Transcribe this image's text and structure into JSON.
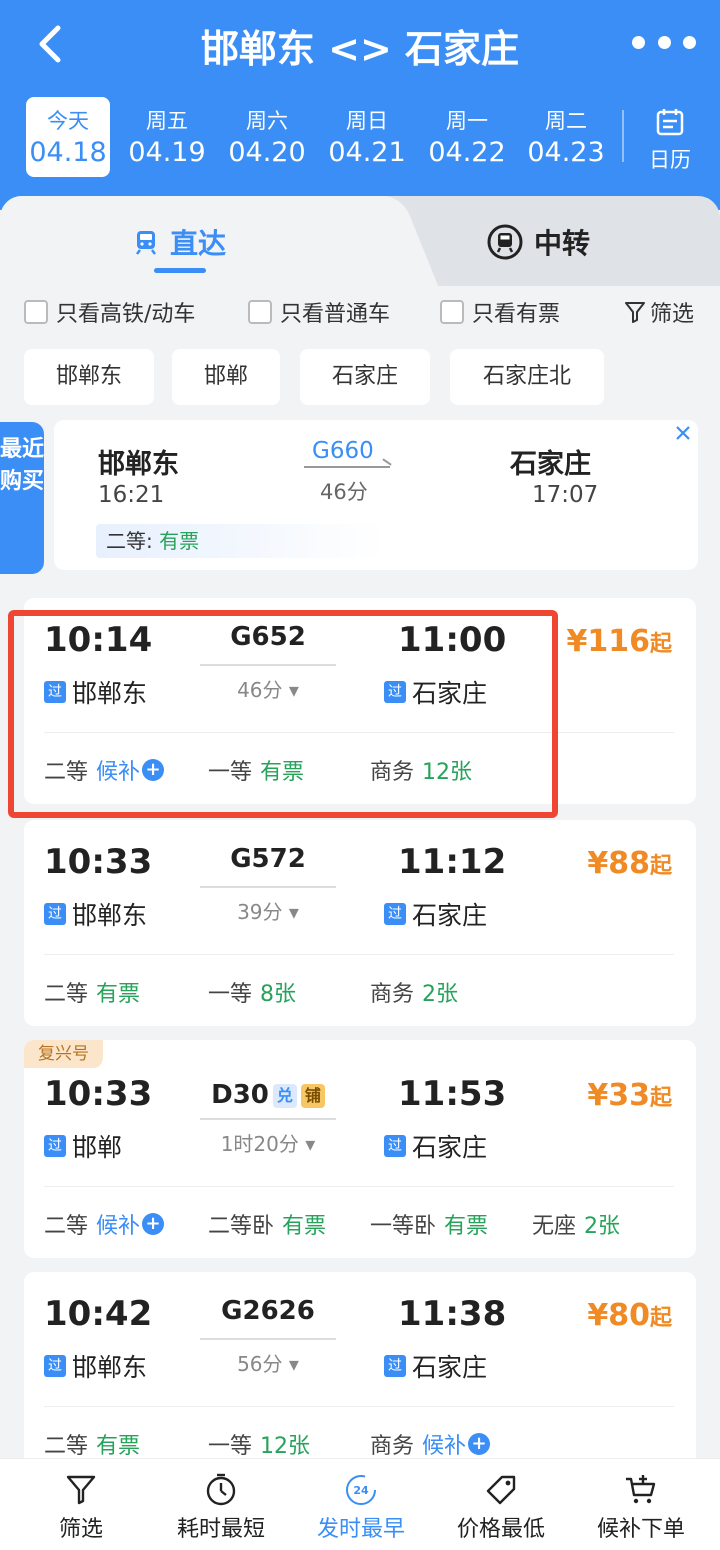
{
  "header": {
    "title": "邯郸东 <> 石家庄",
    "calendar_label": "日历"
  },
  "dates": [
    {
      "week": "今天",
      "date": "04.18",
      "active": true
    },
    {
      "week": "周五",
      "date": "04.19"
    },
    {
      "week": "周六",
      "date": "04.20"
    },
    {
      "week": "周日",
      "date": "04.21"
    },
    {
      "week": "周一",
      "date": "04.22"
    },
    {
      "week": "周二",
      "date": "04.23"
    }
  ],
  "tabs": {
    "direct": "直达",
    "transfer": "中转"
  },
  "filters": {
    "only_gd": "只看高铁/动车",
    "only_normal": "只看普通车",
    "only_available": "只看有票",
    "filter": "筛选"
  },
  "stations": [
    "邯郸东",
    "邯郸",
    "石家庄",
    "石家庄北"
  ],
  "recent": {
    "tag": "最近购买",
    "from": "邯郸东",
    "from_time": "16:21",
    "train": "G660",
    "duration": "46分",
    "to": "石家庄",
    "to_time": "17:07",
    "seat_class": "二等:",
    "seat_status": "有票"
  },
  "trains": [
    {
      "dep": "10:14",
      "arr": "11:00",
      "no": "G652",
      "duration": "46分",
      "from_pass": "过",
      "from": "邯郸东",
      "to_pass": "过",
      "to": "石家庄",
      "price_sym": "¥",
      "price": "116",
      "price_suffix": "起",
      "seats": [
        {
          "cls": "二等",
          "status": "候补"
        },
        {
          "cls": "一等",
          "status": "有票"
        },
        {
          "cls": "商务",
          "status": "12张"
        }
      ]
    },
    {
      "dep": "10:33",
      "arr": "11:12",
      "no": "G572",
      "duration": "39分",
      "from_pass": "过",
      "from": "邯郸东",
      "to_pass": "过",
      "to": "石家庄",
      "price_sym": "¥",
      "price": "88",
      "price_suffix": "起",
      "seats": [
        {
          "cls": "二等",
          "status": "有票"
        },
        {
          "cls": "一等",
          "status": "8张"
        },
        {
          "cls": "商务",
          "status": "2张"
        }
      ]
    },
    {
      "tag": "复兴号",
      "dep": "10:33",
      "arr": "11:53",
      "no": "D30",
      "badge1": "兑",
      "badge2": "铺",
      "duration": "1时20分",
      "from_pass": "过",
      "from": "邯郸",
      "to_pass": "过",
      "to": "石家庄",
      "price_sym": "¥",
      "price": "33",
      "price_suffix": "起",
      "seats": [
        {
          "cls": "二等",
          "status": "候补"
        },
        {
          "cls": "二等卧",
          "status": "有票"
        },
        {
          "cls": "一等卧",
          "status": "有票"
        },
        {
          "cls": "无座",
          "status": "2张"
        }
      ]
    },
    {
      "dep": "10:42",
      "arr": "11:38",
      "no": "G2626",
      "duration": "56分",
      "from_pass": "过",
      "from": "邯郸东",
      "to_pass": "过",
      "to": "石家庄",
      "price_sym": "¥",
      "price": "80",
      "price_suffix": "起",
      "seats": [
        {
          "cls": "二等",
          "status": "有票"
        },
        {
          "cls": "一等",
          "status": "12张"
        },
        {
          "cls": "商务",
          "status": "候补"
        }
      ]
    }
  ],
  "bottom": [
    {
      "label": "筛选",
      "icon": "filter-icon"
    },
    {
      "label": "耗时最短",
      "icon": "clock-icon"
    },
    {
      "label": "发时最早",
      "icon": "24h-icon",
      "active": true,
      "icon_text": "24"
    },
    {
      "label": "价格最低",
      "icon": "price-tag-icon"
    },
    {
      "label": "候补下单",
      "icon": "cart-plus-icon"
    }
  ],
  "colors": {
    "primary": "#3a8ef5",
    "green": "#26a25a",
    "orange": "#f08a24",
    "highlight": "#ef4533"
  }
}
